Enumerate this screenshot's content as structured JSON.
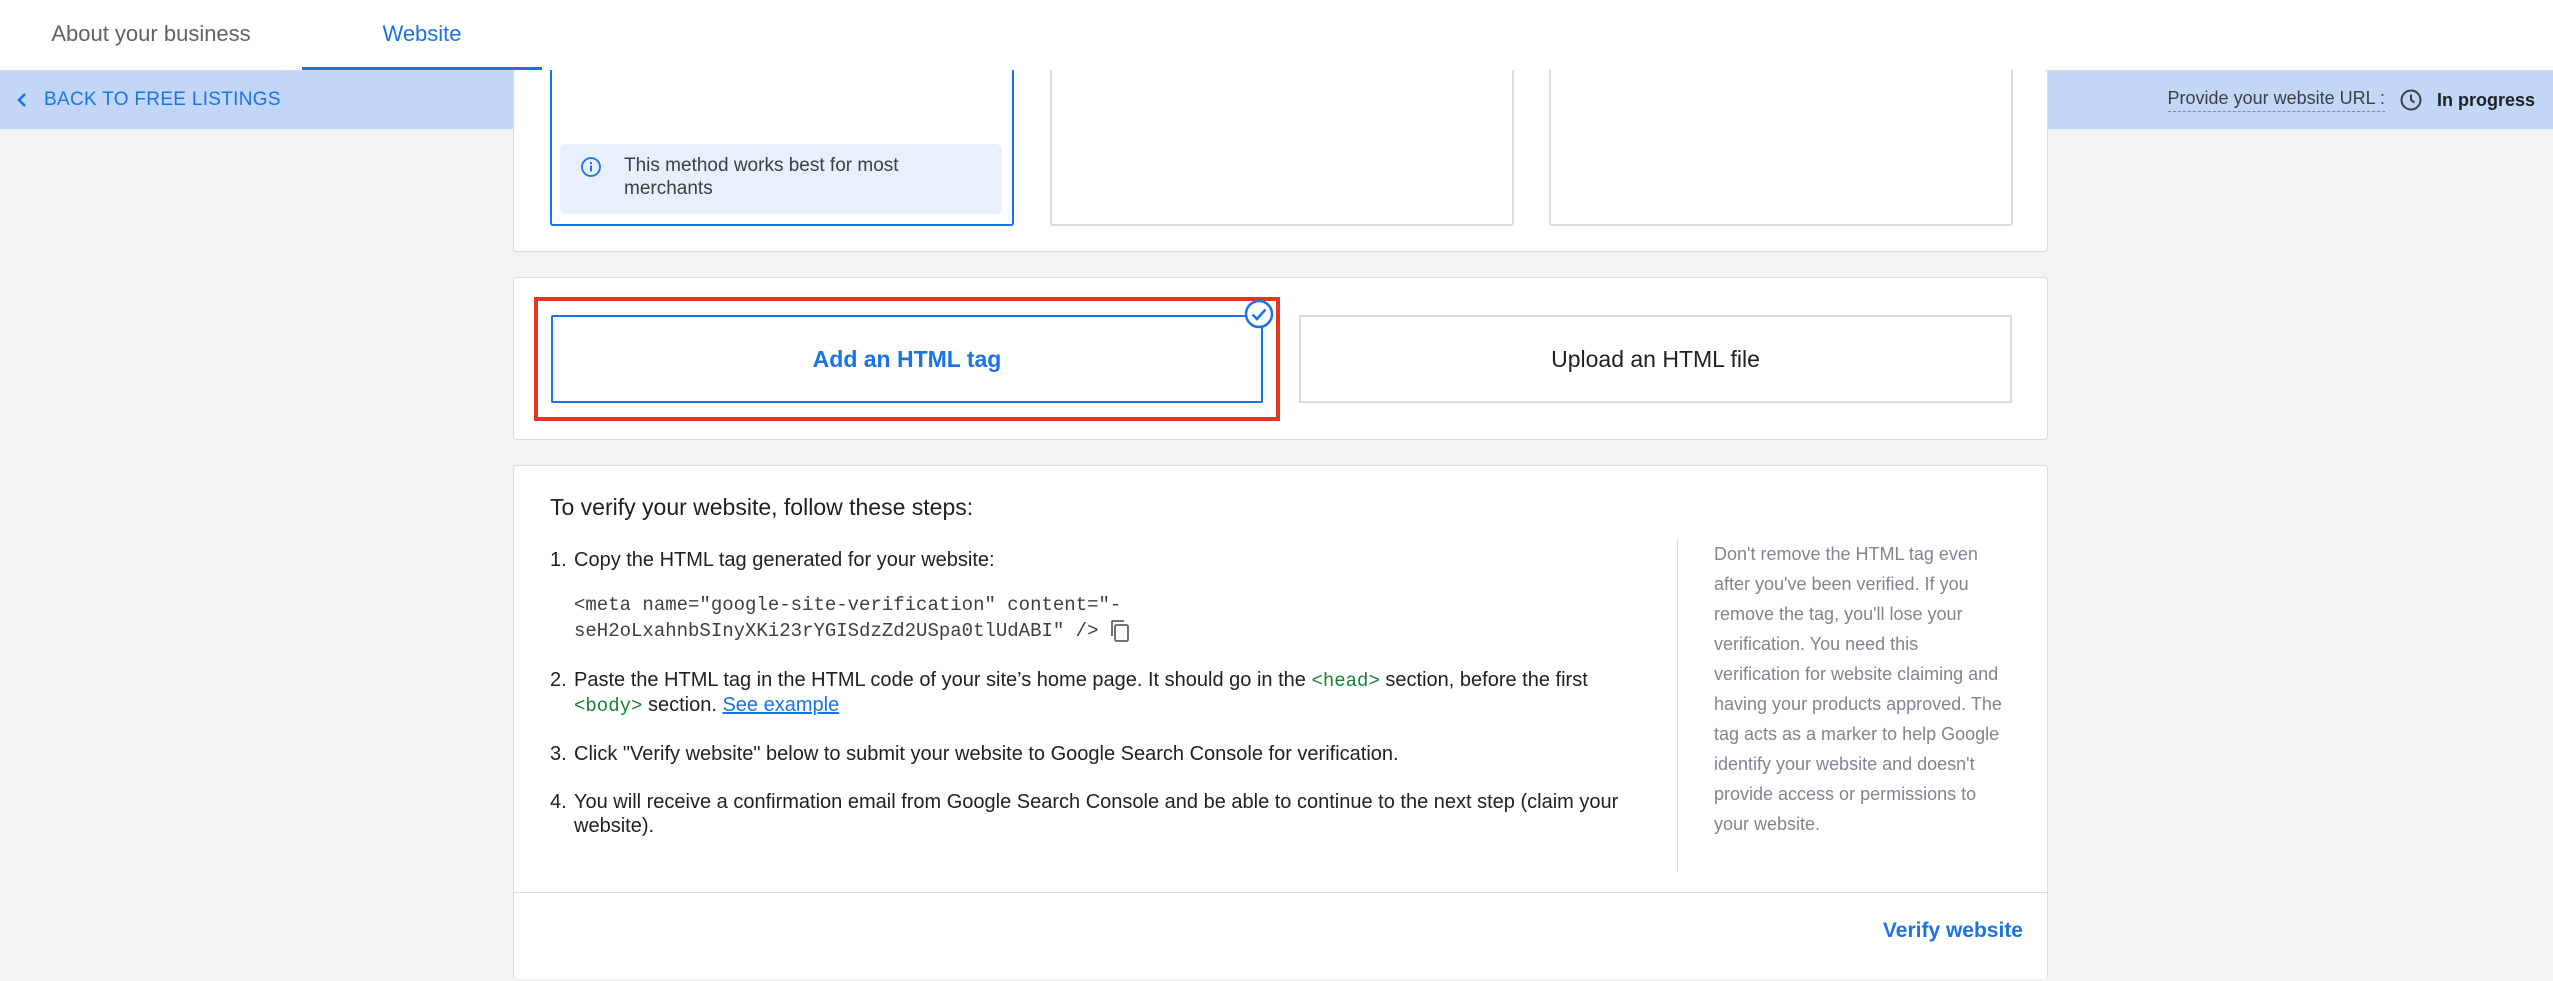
{
  "tabs": {
    "about": "About your business",
    "website": "Website"
  },
  "bar": {
    "back_label": "BACK TO FREE LISTINGS",
    "status_label": "Provide your website URL :",
    "status_value": "In progress"
  },
  "method_card": {
    "info_text": "This method works best for most merchants"
  },
  "html_options": {
    "tag": "Add an HTML tag",
    "file": "Upload an HTML file"
  },
  "instructions": {
    "title": "To verify your website, follow these steps:",
    "step1": "Copy the HTML tag generated for your website:",
    "code_line1": "<meta name=\"google-site-verification\" content=\"-",
    "code_line2": "seH2oLxahnbSInyXKi23rYGISdzZd2USpa0tlUdABI\" />",
    "step2_a": "Paste the HTML tag in the HTML code of your site’s home page. It should go in the ",
    "step2_head": "<head>",
    "step2_b": " section, before the first ",
    "step2_body": "<body>",
    "step2_c": " section. ",
    "step2_link": "See example",
    "step3": "Click \"Verify website\" below to submit your website to Google Search Console for verification.",
    "step4": "You will receive a confirmation email from Google Search Console and be able to continue to the next step (claim your website).",
    "side_note": "Don't remove the HTML tag even after you've been verified. If you remove the tag, you'll lose your verification. You need this verification for website claiming and having your products approved. The tag acts as a marker to help Google identify your website and doesn't provide access or permissions to your website.",
    "verify_button": "Verify website"
  },
  "colors": {
    "accent": "#1a73e8",
    "highlight_box": "#ea3323",
    "status_bar": "#c2d7f8"
  },
  "icons": [
    "chevron-left-icon",
    "clock-icon",
    "info-icon",
    "check-circle-icon",
    "copy-icon"
  ]
}
